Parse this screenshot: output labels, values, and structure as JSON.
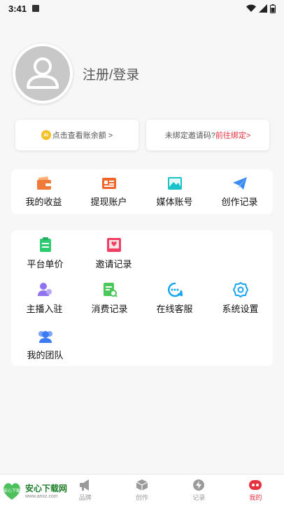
{
  "status_bar": {
    "time": "3:41"
  },
  "profile": {
    "login_text": "注册/登录"
  },
  "balance_card": {
    "coin_text": "AI",
    "text": "点击查看账余额 >"
  },
  "invite_card": {
    "text": "未绑定邀请码?",
    "link": "前往绑定>"
  },
  "panel1": {
    "items": [
      {
        "label": "我的收益",
        "icon": "wallet-icon",
        "color": "#f07a3a"
      },
      {
        "label": "提现账户",
        "icon": "card-icon",
        "color": "#f0652a"
      },
      {
        "label": "媒体账号",
        "icon": "image-icon",
        "color": "#19c2c9"
      },
      {
        "label": "创作记录",
        "icon": "paper-plane-icon",
        "color": "#3b8bf5"
      }
    ]
  },
  "panel2": {
    "items": [
      {
        "label": "平台单价",
        "icon": "clipboard-icon",
        "color": "#2ecc71"
      },
      {
        "label": "邀请记录",
        "icon": "invite-envelope-icon",
        "color": "#ef3f63"
      },
      {
        "label": "主播入驻",
        "icon": "anchor-user-icon",
        "color": "#8f73f0"
      },
      {
        "label": "消费记录",
        "icon": "record-search-icon",
        "color": "#4bc85a"
      },
      {
        "label": "在线客服",
        "icon": "chat-icon",
        "color": "#1aa6ef"
      },
      {
        "label": "系统设置",
        "icon": "gear-icon",
        "color": "#1aa6ef"
      },
      {
        "label": "我的团队",
        "icon": "team-icon",
        "color": "#3d7bf5"
      }
    ]
  },
  "bottom_nav": {
    "items": [
      {
        "label": "",
        "icon": "home-icon"
      },
      {
        "label": "品牌",
        "icon": "megaphone-icon"
      },
      {
        "label": "创作",
        "icon": "cube-icon"
      },
      {
        "label": "记录",
        "icon": "lightning-icon"
      },
      {
        "label": "我的",
        "icon": "profile-face-icon"
      }
    ],
    "active_index": 4
  },
  "watermark": {
    "title": "安心下载网",
    "url": "www.anxz.com",
    "badge": "安心下载"
  },
  "colors": {
    "accent": "#e8313f",
    "background": "#f7f7f7"
  }
}
